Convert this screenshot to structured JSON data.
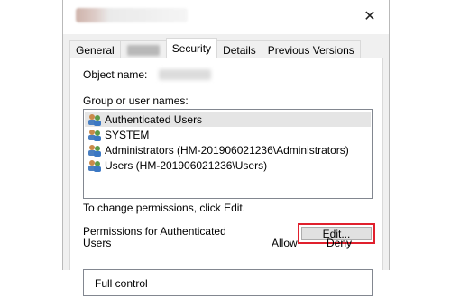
{
  "window": {
    "close_glyph": "✕"
  },
  "tabs": [
    {
      "label": "General"
    },
    {
      "label": ""
    },
    {
      "label": "Security"
    },
    {
      "label": "Details"
    },
    {
      "label": "Previous Versions"
    }
  ],
  "security": {
    "object_name_label": "Object name:",
    "group_label": "Group or user names:",
    "users": [
      {
        "name": "Authenticated Users",
        "selected": true,
        "icon": "users-group-icon"
      },
      {
        "name": "SYSTEM",
        "selected": false,
        "icon": "users-group-icon"
      },
      {
        "name": "Administrators (HM-201906021236\\Administrators)",
        "selected": false,
        "icon": "users-group-icon"
      },
      {
        "name": "Users (HM-201906021236\\Users)",
        "selected": false,
        "icon": "users-group-icon"
      }
    ],
    "change_perm_text": "To change permissions, click Edit.",
    "edit_label": "Edit...",
    "permissions_for_line1": "Permissions for Authenticated",
    "permissions_for_line2": "Users",
    "allow_header": "Allow",
    "deny_header": "Deny",
    "permissions": [
      {
        "name": "Full control"
      }
    ]
  },
  "colors": {
    "highlight_border": "#e0202d",
    "selected_row": "#e5e5e5",
    "panel_bg": "#f0f0f0"
  }
}
